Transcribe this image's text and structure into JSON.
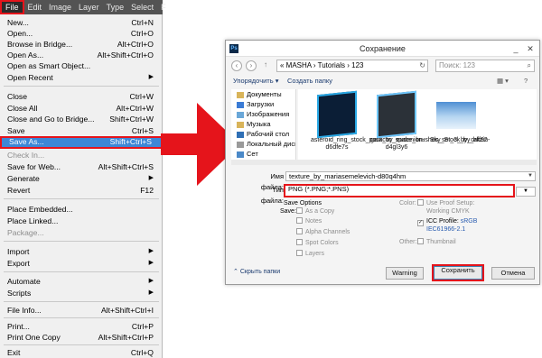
{
  "menubar": {
    "items": [
      "File",
      "Edit",
      "Image",
      "Layer",
      "Type",
      "Select",
      "F"
    ]
  },
  "filemenu": {
    "items": [
      {
        "label": "New...",
        "shortcut": "Ctrl+N"
      },
      {
        "label": "Open...",
        "shortcut": "Ctrl+O"
      },
      {
        "label": "Browse in Bridge...",
        "shortcut": "Alt+Ctrl+O"
      },
      {
        "label": "Open As...",
        "shortcut": "Alt+Shift+Ctrl+O"
      },
      {
        "label": "Open as Smart Object...",
        "shortcut": ""
      },
      {
        "label": "Open Recent",
        "shortcut": ""
      },
      {
        "label": "Close",
        "shortcut": "Ctrl+W"
      },
      {
        "label": "Close All",
        "shortcut": "Alt+Ctrl+W"
      },
      {
        "label": "Close and Go to Bridge...",
        "shortcut": "Shift+Ctrl+W"
      },
      {
        "label": "Save",
        "shortcut": "Ctrl+S"
      },
      {
        "label": "Save As...",
        "shortcut": "Shift+Ctrl+S"
      },
      {
        "label": "Check In...",
        "shortcut": ""
      },
      {
        "label": "Save for Web...",
        "shortcut": "Alt+Shift+Ctrl+S"
      },
      {
        "label": "Generate",
        "shortcut": ""
      },
      {
        "label": "Revert",
        "shortcut": "F12"
      },
      {
        "label": "Place Embedded...",
        "shortcut": ""
      },
      {
        "label": "Place Linked...",
        "shortcut": ""
      },
      {
        "label": "Package...",
        "shortcut": ""
      },
      {
        "label": "Import",
        "shortcut": ""
      },
      {
        "label": "Export",
        "shortcut": ""
      },
      {
        "label": "Automate",
        "shortcut": ""
      },
      {
        "label": "Scripts",
        "shortcut": ""
      },
      {
        "label": "File Info...",
        "shortcut": "Alt+Shift+Ctrl+I"
      },
      {
        "label": "Print...",
        "shortcut": "Ctrl+P"
      },
      {
        "label": "Print One Copy",
        "shortcut": "Alt+Shift+Ctrl+P"
      },
      {
        "label": "Exit",
        "shortcut": "Ctrl+Q"
      }
    ]
  },
  "dialog": {
    "title": "Сохранение",
    "app_icon": "Ps",
    "address": "« MASHA › Tutorials › 123",
    "search_placeholder": "Поиск: 123",
    "organize_label": "Упорядочить ▾",
    "new_folder_label": "Создать папку",
    "nav_items": [
      "Документы",
      "Загрузки",
      "Изображения",
      "Музыка",
      "Рабочий стол",
      "Локальный диск",
      "Сет"
    ],
    "files": [
      {
        "caption": "asteroid_ring_stock_pack_by_eudenion-d6dfe7s",
        "thumb": "box-blue"
      },
      {
        "caption": "galactic_space_brushes_set_3_by_drkzin-d4gl3y6",
        "thumb": "box-dark"
      },
      {
        "caption": "Sky_Stock_by_aff92",
        "thumb": "sky"
      }
    ],
    "filename_label": "Имя файла:",
    "filename_value": "texture_by_mariasemelevich-d80q4hm",
    "filetype_label": "Тип файла:",
    "filetype_value": "PNG (*.PNG;*.PNS)",
    "save_options_title": "Save Options",
    "save_label": "Save:",
    "options": [
      {
        "label": "As a Copy",
        "checked": false
      },
      {
        "label": "Notes",
        "checked": false
      },
      {
        "label": "Alpha Channels",
        "checked": false
      },
      {
        "label": "Spot Colors",
        "checked": false
      },
      {
        "label": "Layers",
        "checked": false
      }
    ],
    "color_label": "Color:",
    "proof_label": "Use Proof Setup:",
    "proof_sub": "Working CMYK",
    "icc_label": "ICC Profile:",
    "icc_value": "sRGB",
    "icc_sub": "IEC61966-2.1",
    "other_label": "Other:",
    "thumbnail_label": "Thumbnail",
    "hide_folders_label": "Скрыть папки",
    "warning_button": "Warning",
    "save_button": "Сохранить",
    "cancel_button": "Отмена"
  },
  "colors": {
    "highlight_red": "#e5141b",
    "menu_selection": "#3d87d6",
    "menubar_bg": "#535353"
  }
}
